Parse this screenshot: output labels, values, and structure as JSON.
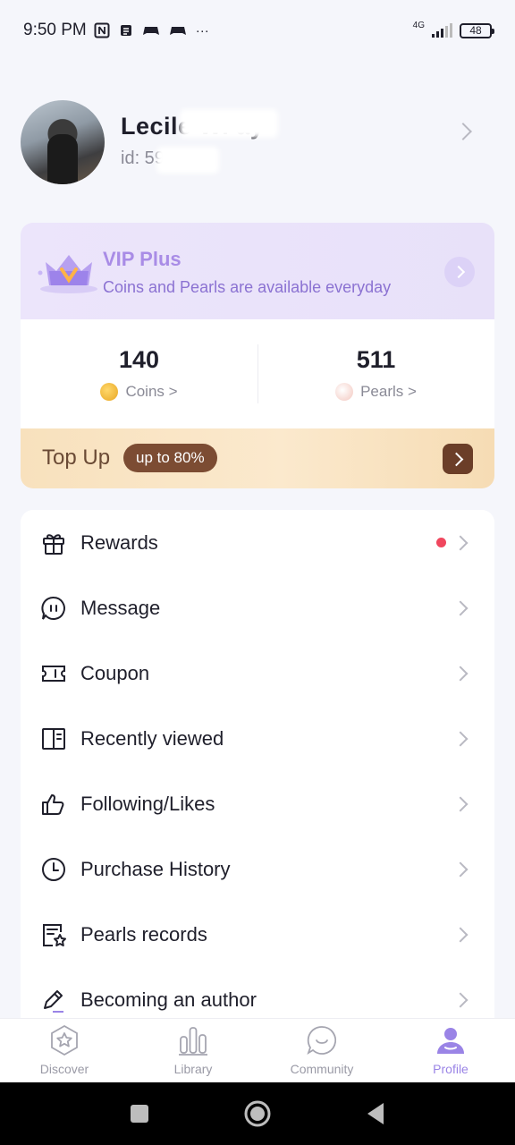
{
  "status_bar": {
    "time": "9:50 PM",
    "network": "4G",
    "battery": "48",
    "more": "···"
  },
  "profile": {
    "name": "Lecile Wi   ay",
    "id_label": "id:           59"
  },
  "vip": {
    "title": "VIP Plus",
    "subtitle": "Coins and Pearls are available everyday"
  },
  "balances": {
    "coins_value": "140",
    "coins_label": "Coins >",
    "pearls_value": "511",
    "pearls_label": "Pearls >"
  },
  "topup": {
    "label": "Top Up",
    "badge": "up to 80%"
  },
  "menu": {
    "items": [
      {
        "label": "Rewards",
        "icon": "gift-icon",
        "has_dot": true
      },
      {
        "label": "Message",
        "icon": "message-icon"
      },
      {
        "label": "Coupon",
        "icon": "coupon-icon"
      },
      {
        "label": "Recently viewed",
        "icon": "book-icon"
      },
      {
        "label": "Following/Likes",
        "icon": "thumbs-up-icon"
      },
      {
        "label": "Purchase History",
        "icon": "clock-icon"
      },
      {
        "label": "Pearls records",
        "icon": "star-document-icon"
      },
      {
        "label": "Becoming an author",
        "icon": "pen-icon"
      }
    ]
  },
  "bottom_nav": {
    "items": [
      {
        "label": "Discover",
        "icon": "star-hexagon-icon"
      },
      {
        "label": "Library",
        "icon": "bar-chart-icon"
      },
      {
        "label": "Community",
        "icon": "chat-bubble-icon"
      },
      {
        "label": "Profile",
        "icon": "person-icon",
        "active": true
      }
    ]
  },
  "colors": {
    "accent": "#9a84e6",
    "vip_text": "#a98ce6",
    "topup_brown": "#7c4c33",
    "notification_red": "#f0475e"
  }
}
